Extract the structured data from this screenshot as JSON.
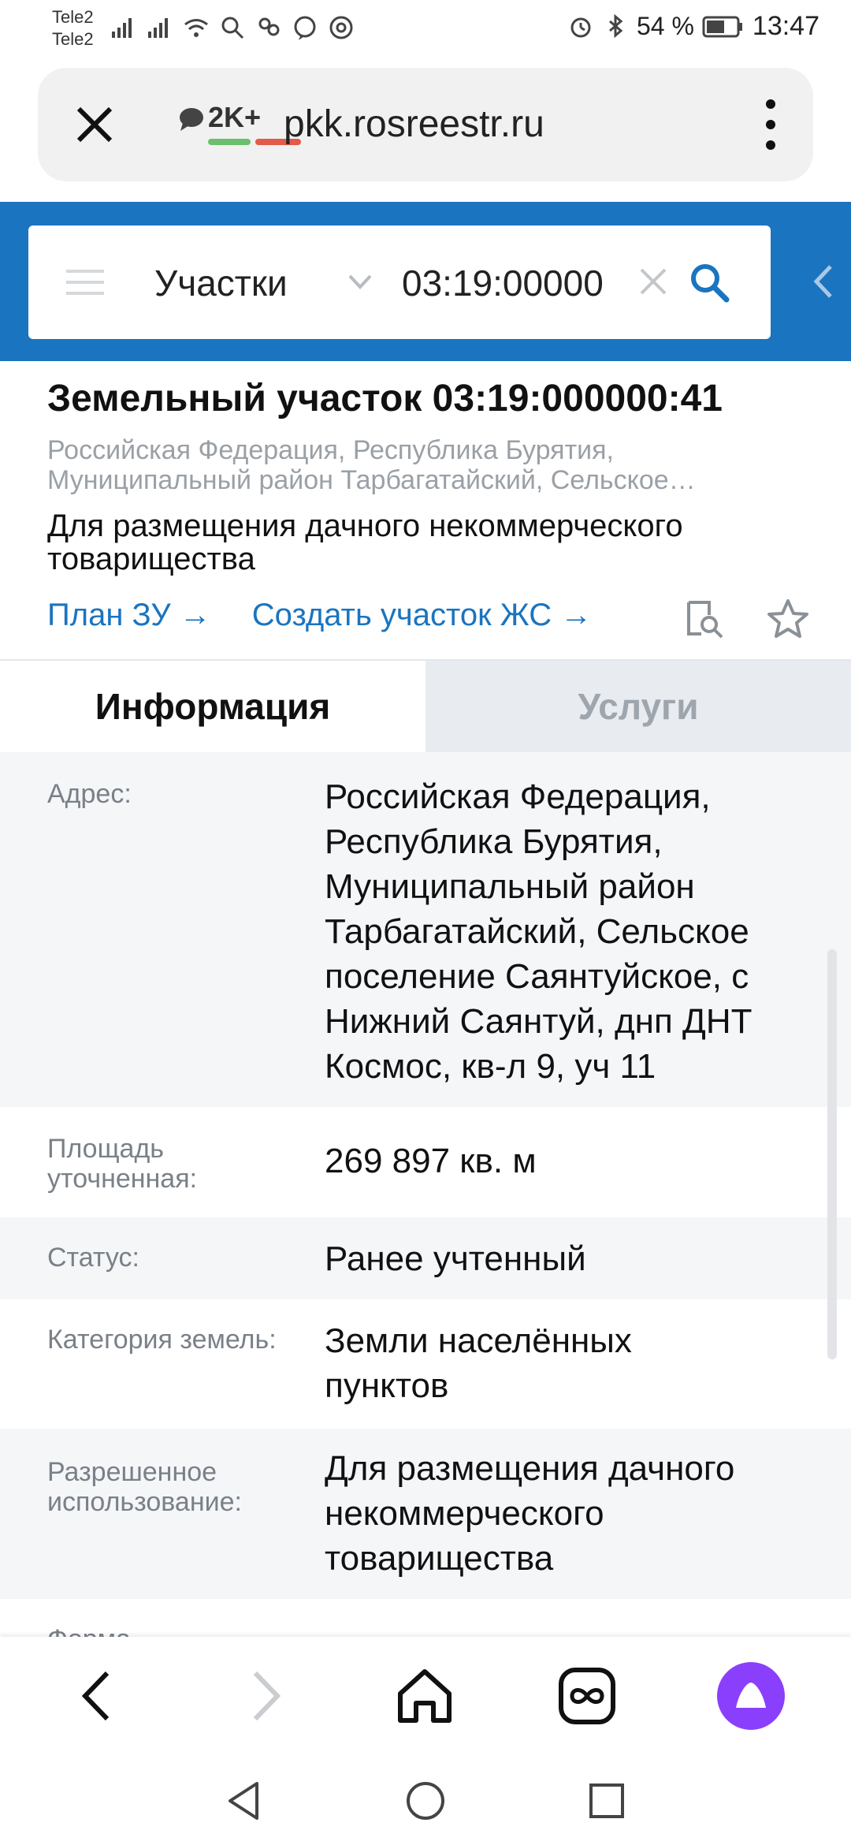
{
  "status_bar": {
    "carrier1": "Tele2",
    "carrier2": "Tele2",
    "battery": "54 %",
    "time": "13:47"
  },
  "browser": {
    "badge": "2K+",
    "url": "pkk.rosreestr.ru"
  },
  "search": {
    "category": "Участки",
    "query": "03:19:00000("
  },
  "parcel": {
    "title": "Земельный участок 03:19:000000:41",
    "address_short": "Российская Федерация, Республика Бурятия, Муниципальный район Тарбагатайский, Сельское…",
    "purpose": "Для размещения дачного некоммерческого товарищества",
    "link_plan": "План ЗУ →",
    "link_create": "Создать участок ЖС →"
  },
  "tabs": {
    "info": "Информация",
    "services": "Услуги"
  },
  "rows": [
    {
      "label": "Адрес:",
      "value": "Российская Федерация, Республика Бурятия, Муниципальный район Тарбагатайский, Сельское поселение Саянтуйское, с Нижний Саянтуй, днп ДНТ Космос, кв-л 9, уч 11"
    },
    {
      "label": "Площадь уточненная:",
      "value": "269 897 кв. м"
    },
    {
      "label": "Статус:",
      "value": "Ранее учтенный"
    },
    {
      "label": "Категория земель:",
      "value": "Земли населённых пунктов"
    },
    {
      "label": "Разрешенное использование:",
      "value": "Для размещения дачного некоммерческого товарищества"
    }
  ],
  "cut_label": "Форма",
  "colors": {
    "header_blue": "#1a74c0",
    "link_blue": "#1a74c0",
    "alice_purple": "#8a3ffc"
  }
}
